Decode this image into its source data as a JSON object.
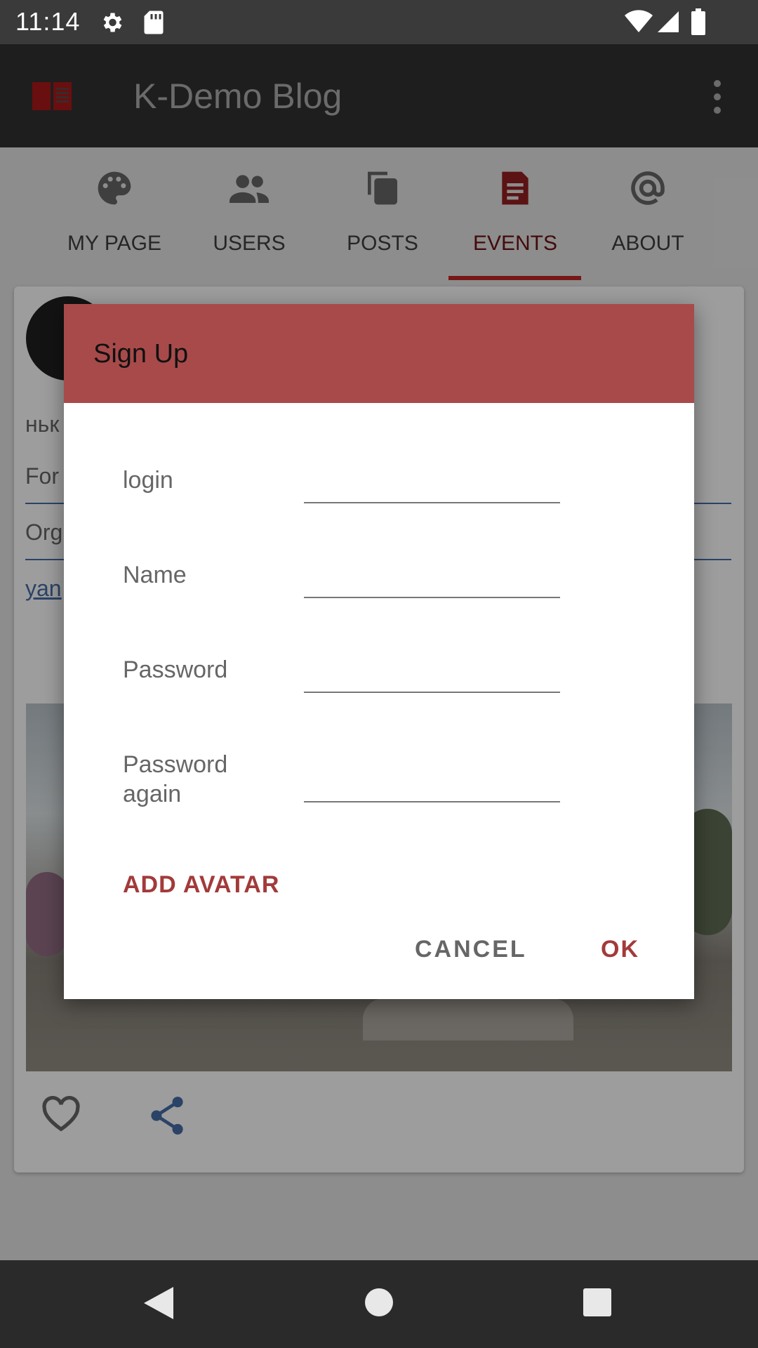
{
  "status_bar": {
    "time": "11:14"
  },
  "app_bar": {
    "title": "K-Demo Blog"
  },
  "tabs": [
    {
      "label": "MY PAGE",
      "icon": "palette-icon"
    },
    {
      "label": "USERS",
      "icon": "people-icon"
    },
    {
      "label": "POSTS",
      "icon": "copy-icon"
    },
    {
      "label": "EVENTS",
      "icon": "document-icon",
      "active": true
    },
    {
      "label": "ABOUT",
      "icon": "at-icon"
    }
  ],
  "card": {
    "text_line": "ньк",
    "field_1": "For",
    "field_2": "Org",
    "link": "yan"
  },
  "dialog": {
    "title": "Sign Up",
    "fields": [
      {
        "label": "login",
        "value": ""
      },
      {
        "label": "Name",
        "value": ""
      },
      {
        "label": "Password",
        "value": ""
      },
      {
        "label": "Password again",
        "value": ""
      }
    ],
    "add_avatar": "ADD AVATAR",
    "cancel": "CANCEL",
    "ok": "OK"
  },
  "colors": {
    "accent": "#a84a4a",
    "accent_text": "#a33a3a",
    "active_tab": "#a11f1f",
    "link": "#3a5a8a"
  }
}
